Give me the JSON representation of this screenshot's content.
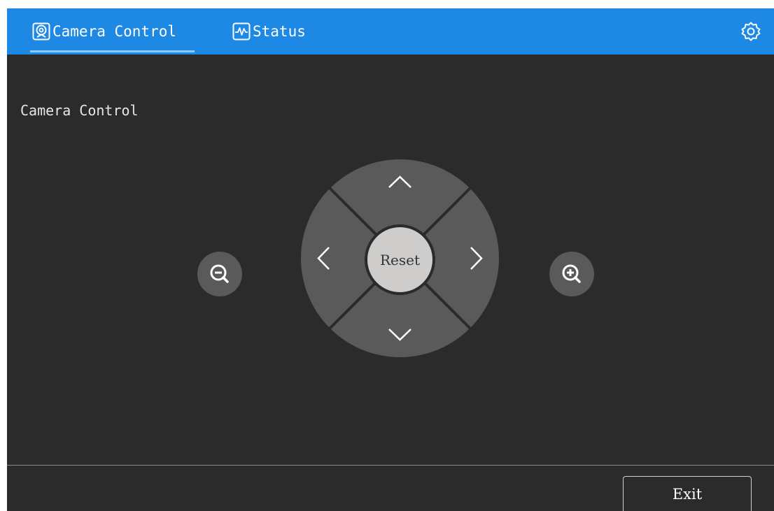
{
  "tabs": [
    {
      "label": "Camera Control",
      "icon": "webcam-icon",
      "active": true
    },
    {
      "label": "Status",
      "icon": "pulse-icon",
      "active": false
    }
  ],
  "settings": {
    "icon": "gear-icon"
  },
  "section": {
    "title": "Camera Control"
  },
  "controls": {
    "reset_label": "Reset",
    "up_icon": "chevron-up-icon",
    "down_icon": "chevron-down-icon",
    "left_icon": "chevron-left-icon",
    "right_icon": "chevron-right-icon",
    "zoom_out_icon": "zoom-out-icon",
    "zoom_in_icon": "zoom-in-icon"
  },
  "footer": {
    "exit_label": "Exit"
  },
  "colors": {
    "header": "#1e88e5",
    "background": "#2b2b2b",
    "pad": "#5a5a5a",
    "reset": "#cfcccc"
  }
}
